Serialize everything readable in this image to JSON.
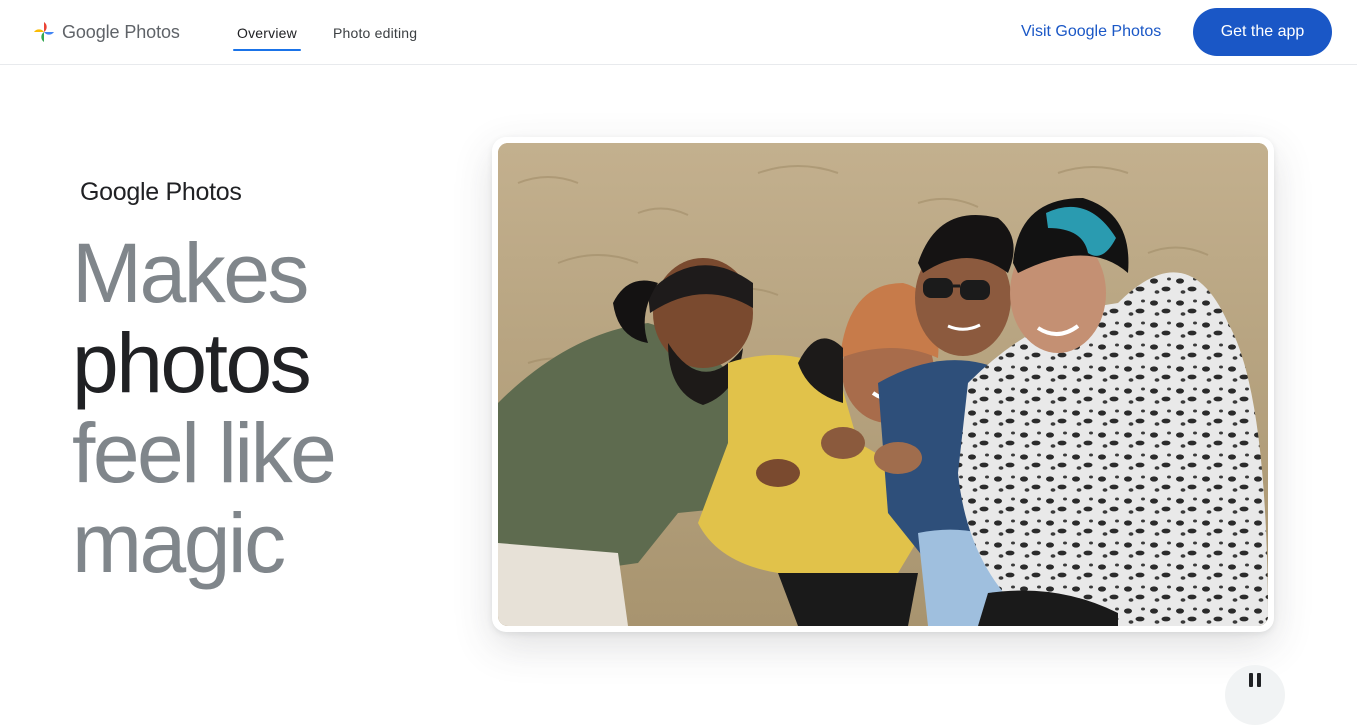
{
  "header": {
    "logo_google": "Google",
    "logo_product": "Photos",
    "tabs": [
      {
        "label": "Overview",
        "active": true
      },
      {
        "label": "Photo editing",
        "active": false
      }
    ],
    "visit_link": "Visit Google Photos",
    "cta_label": "Get the app"
  },
  "hero": {
    "brand_google": "Google",
    "brand_product": "Photos",
    "headline_lines": [
      "Makes",
      "photos",
      "feel like",
      "magic"
    ]
  },
  "carousel": {
    "pause_icon": "pause-icon"
  },
  "colors": {
    "accent_blue": "#1a57c6",
    "tab_underline": "#1a73e8",
    "headline_muted": "#80868b",
    "headline_dark": "#202124"
  }
}
